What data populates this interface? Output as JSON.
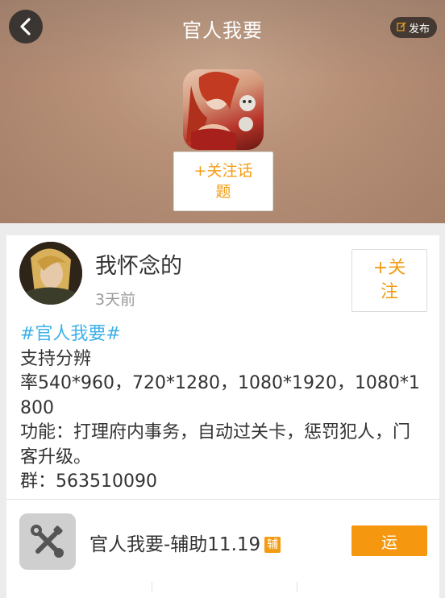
{
  "header": {
    "title": "官人我要",
    "publish_label": "发布",
    "follow_topic_label": "+关注话题"
  },
  "post": {
    "author": "我怀念的",
    "time": "3天前",
    "follow_label": "+关注",
    "hashtag": "#官人我要#",
    "lines": [
      "支持分辨",
      "率540*960，720*1280，1080*1920，1080*1800",
      "功能：打理府内事务，自动过关卡，惩罚犯人，门客升级。",
      "群：563510090"
    ]
  },
  "attachment": {
    "name": "官人我要-辅助11.19",
    "badge": "辅",
    "action_label": "运"
  },
  "colors": {
    "accent": "#f39c12",
    "hashtag": "#3fb0e8"
  },
  "icons": [
    "back-arrow-icon",
    "edit-icon",
    "tools-icon"
  ]
}
